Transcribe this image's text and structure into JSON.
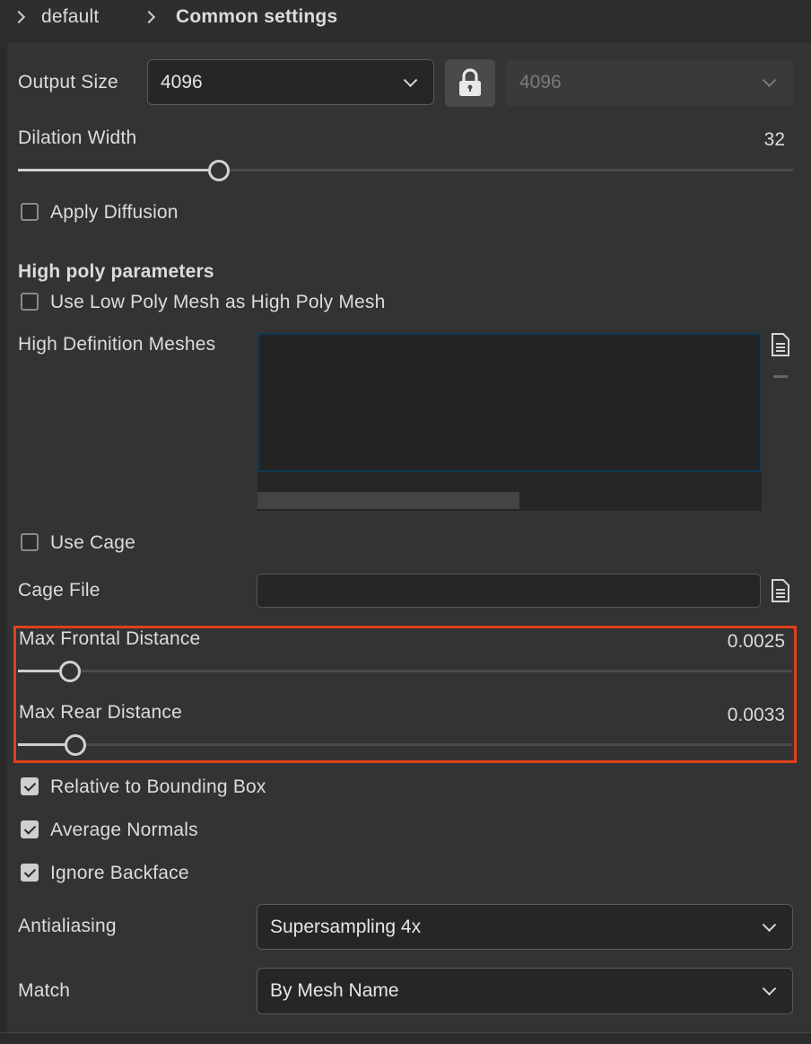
{
  "breadcrumb": {
    "item1": "default",
    "item2": "Common settings"
  },
  "output_size": {
    "label": "Output Size",
    "value": "4096",
    "linked_value": "4096"
  },
  "dilation_width": {
    "label": "Dilation Width",
    "value": "32",
    "level": 0.255
  },
  "apply_diffusion": {
    "label": "Apply Diffusion",
    "checked": false
  },
  "high_poly": {
    "heading": "High poly parameters",
    "use_low_poly": {
      "label": "Use Low Poly Mesh as High Poly Mesh",
      "checked": false
    },
    "meshes_label": "High Definition Meshes"
  },
  "use_cage": {
    "label": "Use Cage",
    "checked": false
  },
  "cage_file": {
    "label": "Cage File",
    "value": ""
  },
  "max_frontal": {
    "label": "Max Frontal Distance",
    "value": "0.0025",
    "level": 0.066
  },
  "max_rear": {
    "label": "Max Rear Distance",
    "value": "0.0033",
    "level": 0.074
  },
  "relative_bbox": {
    "label": "Relative to Bounding Box",
    "checked": true
  },
  "average_normals": {
    "label": "Average Normals",
    "checked": true
  },
  "ignore_backface": {
    "label": "Ignore Backface",
    "checked": true
  },
  "antialiasing": {
    "label": "Antialiasing",
    "value": "Supersampling 4x"
  },
  "match": {
    "label": "Match",
    "value": "By Mesh Name"
  },
  "colors": {
    "highlight": "#e0401c",
    "list_border": "#0e3a52"
  }
}
